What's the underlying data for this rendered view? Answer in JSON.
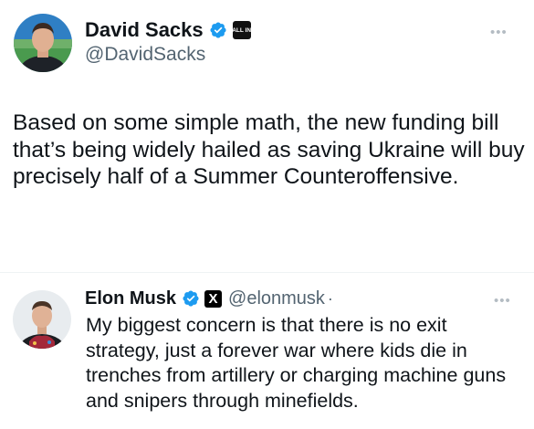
{
  "tweet": {
    "author": {
      "display_name": "David Sacks",
      "handle": "@DavidSacks",
      "affiliation_badge": "ALL IN"
    },
    "text": "Based on some simple math, the new funding bill that’s being widely hailed as saving Ukraine will buy precisely half of a Summer Counteroffensive.",
    "more_icon": "more-dots-icon"
  },
  "reply": {
    "author": {
      "display_name": "Elon Musk",
      "handle": "@elonmusk",
      "affiliation_badge": "X"
    },
    "separator": "·",
    "text": "My biggest concern is that there is no exit strategy, just a forever war where kids die in trenches from artillery or charging machine guns and snipers through minefields.",
    "more_icon": "more-dots-icon"
  },
  "colors": {
    "text": "#0f1419",
    "secondary": "#536471",
    "verified": "#1d9bf0"
  },
  "icons": {
    "verified": "verified-badge-icon",
    "more": "ellipsis-icon"
  }
}
